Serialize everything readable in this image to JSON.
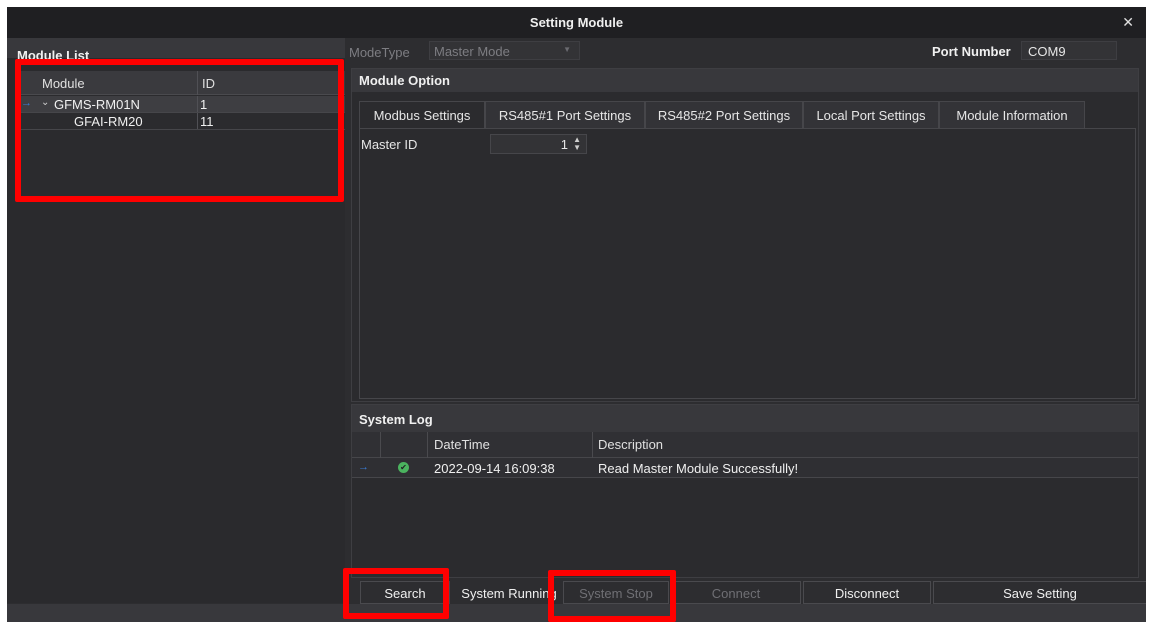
{
  "window": {
    "title": "Setting Module",
    "close_glyph": "✕"
  },
  "left_panel": {
    "title": "Module List",
    "columns": [
      "Module",
      "ID"
    ],
    "rows": [
      {
        "module": "GFMS-RM01N",
        "id": "1",
        "expanded": true
      },
      {
        "module": "GFAI-RM20",
        "id": "11",
        "expanded": false
      }
    ]
  },
  "top_bar": {
    "mode_type_label": "ModeType",
    "mode_type_value": "Master Mode",
    "port_number_label": "Port Number",
    "port_number_value": "COM9"
  },
  "module_option": {
    "title": "Module Option",
    "tabs": [
      "Modbus Settings",
      "RS485#1 Port Settings",
      "RS485#2 Port Settings",
      "Local Port Settings",
      "Module Information"
    ],
    "active_tab": "Modbus Settings",
    "master_id_label": "Master ID",
    "master_id_value": "1"
  },
  "system_log": {
    "title": "System Log",
    "columns": [
      "DateTime",
      "Description"
    ],
    "rows": [
      {
        "datetime": "2022-09-14 16:09:38",
        "description": "Read Master Module Successfully!",
        "status": "success"
      }
    ]
  },
  "buttons": {
    "search": "Search",
    "system_running": "System Running",
    "system_stop": "System Stop",
    "connect": "Connect",
    "disconnect": "Disconnect",
    "save_setting": "Save Setting"
  },
  "icons": {
    "row_indicator": "→",
    "expand": "⌄",
    "success": "✔",
    "spin_up": "▲",
    "spin_down": "▼",
    "dropdown": "▼"
  },
  "colors": {
    "background": "#2d2d30",
    "highlight": "#ff0000",
    "accent": "#3a7bd5",
    "success": "#4bb35f"
  }
}
